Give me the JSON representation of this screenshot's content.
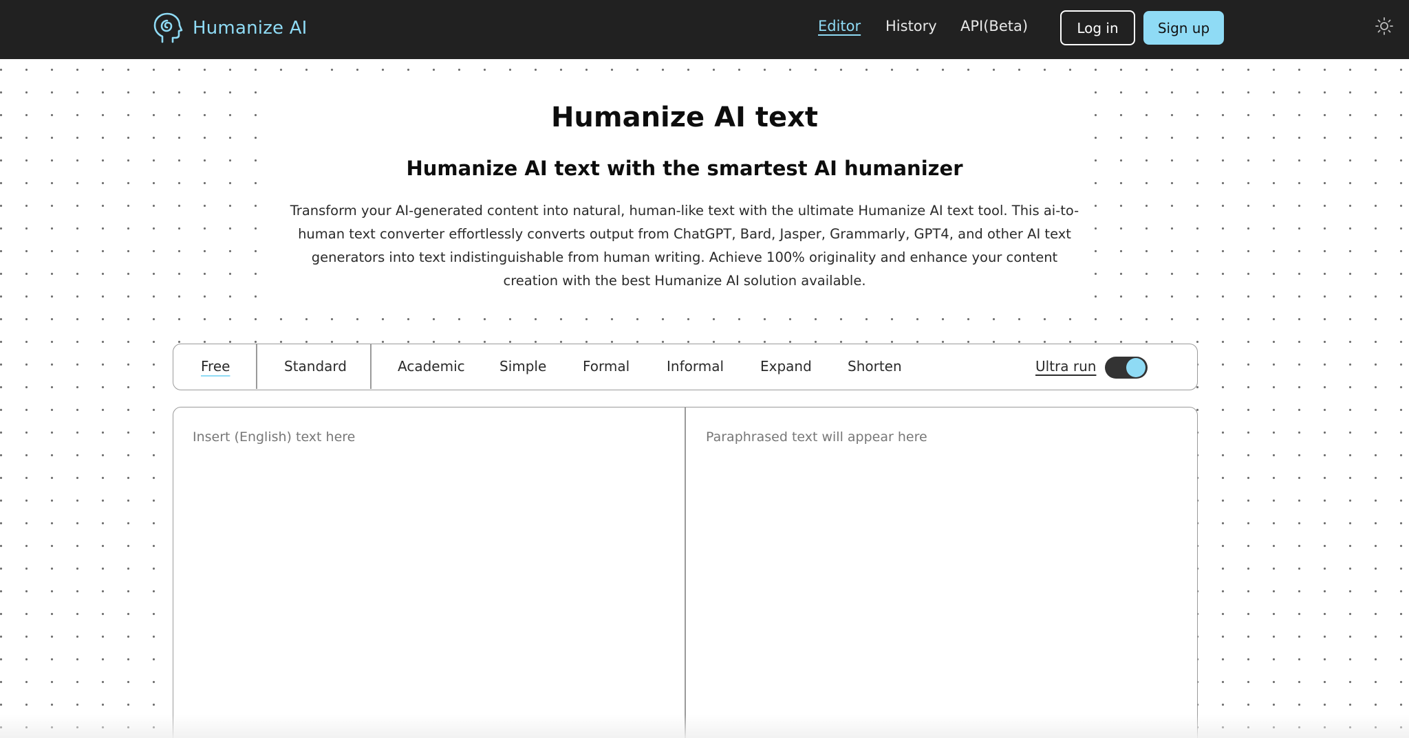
{
  "header": {
    "brand_name": "Humanize AI",
    "nav": [
      {
        "label": "Editor",
        "active": true
      },
      {
        "label": "History",
        "active": false
      },
      {
        "label": "API(Beta)",
        "active": false
      }
    ],
    "login_label": "Log in",
    "signup_label": "Sign up",
    "theme_icon": "sun-icon"
  },
  "hero": {
    "title": "Humanize AI text",
    "subtitle": "Humanize AI text with the smartest AI humanizer",
    "description": "Transform your AI-generated content into natural, human-like text with the ultimate Humanize AI text tool. This ai-to-human text converter effortlessly converts output from ChatGPT, Bard, Jasper, Grammarly, GPT4, and other AI text generators into text indistinguishable from human writing. Achieve 100% originality and enhance your content creation with the best Humanize AI solution available."
  },
  "modes": {
    "items": [
      {
        "label": "Free",
        "active": true
      },
      {
        "label": "Standard",
        "active": false
      },
      {
        "label": "Academic",
        "active": false
      },
      {
        "label": "Simple",
        "active": false
      },
      {
        "label": "Formal",
        "active": false
      },
      {
        "label": "Informal",
        "active": false
      },
      {
        "label": "Expand",
        "active": false
      },
      {
        "label": "Shorten",
        "active": false
      }
    ],
    "ultra_run_label": "Ultra run",
    "ultra_run_on": true
  },
  "editor": {
    "input_placeholder": "Insert (English) text here",
    "output_placeholder": "Paraphrased text will appear here"
  },
  "colors": {
    "accent": "#8fdbf5",
    "header_bg": "#212121"
  }
}
